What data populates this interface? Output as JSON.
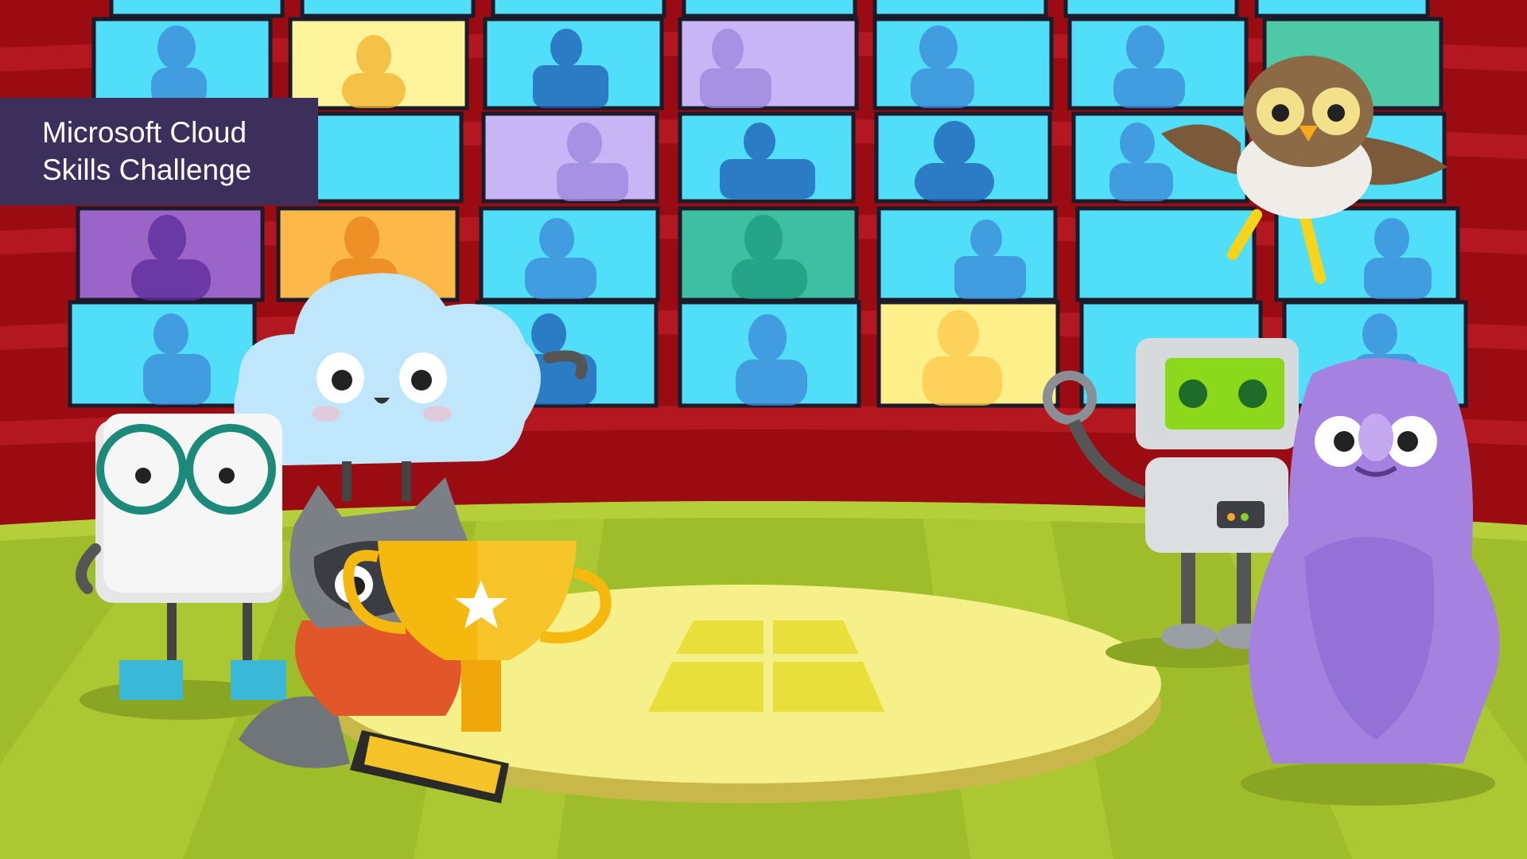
{
  "banner": {
    "title_line1": "Microsoft Cloud",
    "title_line2": "Skills Challenge"
  },
  "palette": {
    "wall": "#9a0b12",
    "wall_stripe": "#b31820",
    "floor": "#9fbd2a",
    "floor_stripe": "#b4cf3a",
    "spotlight": "#f6f08a",
    "screen_blue": "#50def8",
    "banner_bg": "#3d2f5c"
  },
  "characters": [
    "cloud-character",
    "book-character",
    "raccoon-character",
    "owl-character",
    "robot-character",
    "purple-monster-character"
  ],
  "icons": [
    "trophy-icon",
    "windows-logo-icon"
  ]
}
